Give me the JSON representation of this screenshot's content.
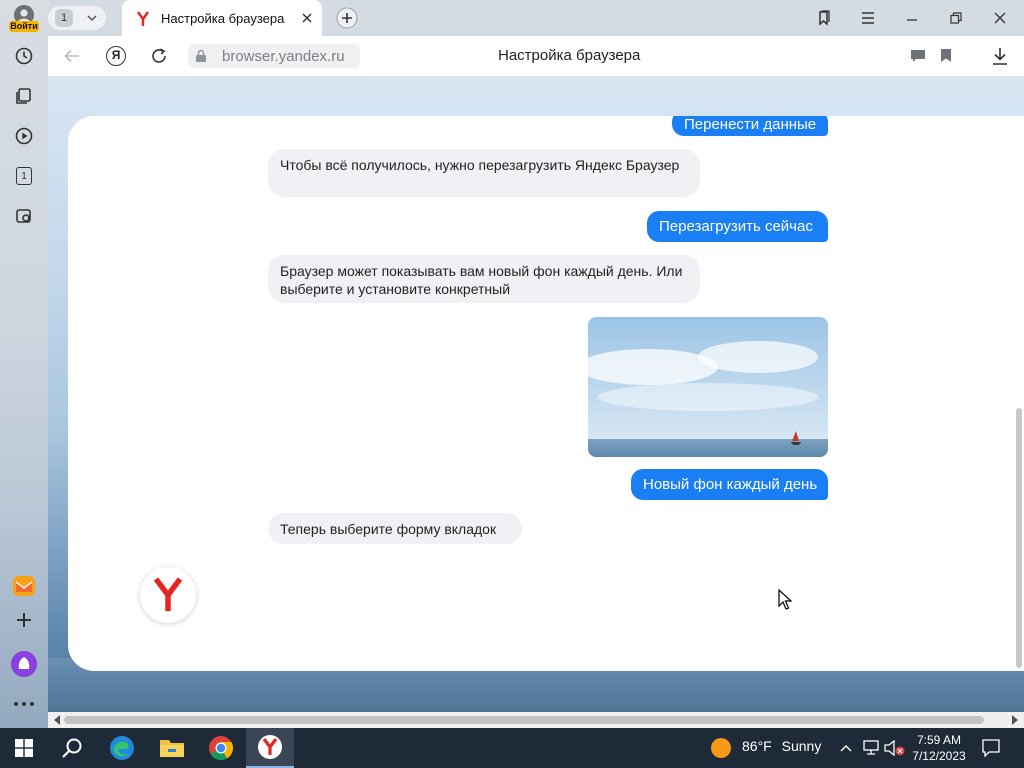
{
  "sidebar": {
    "login_label": "Войти",
    "items": [
      {
        "name": "history-icon"
      },
      {
        "name": "collections-icon"
      },
      {
        "name": "play-icon"
      },
      {
        "name": "tab-count-icon",
        "label": "1"
      },
      {
        "name": "screenshot-icon"
      }
    ]
  },
  "titlebar": {
    "tab_count": "1",
    "tab_title": "Настройка браузера"
  },
  "navbar": {
    "url": "browser.yandex.ru",
    "page_title": "Настройка браузера"
  },
  "chat": {
    "top_button": "Перенести данные",
    "msg_restart": "Чтобы всё получилось, нужно перезагрузить Яндекс Браузер",
    "restart_button": "Перезагрузить сейчас",
    "msg_background": "Браузер может показывать вам новый фон каждый день. Или выберите и установите конкретный",
    "background_button": "Новый фон каждый день",
    "msg_tabs": "Теперь выберите форму вкладок"
  },
  "taskbar": {
    "temperature": "86°F",
    "condition": "Sunny",
    "time": "7:59 AM",
    "date": "7/12/2023"
  },
  "colors": {
    "accent": "#1a7ef5",
    "yandex_red": "#e52620",
    "taskbar": "#1f2a38"
  }
}
